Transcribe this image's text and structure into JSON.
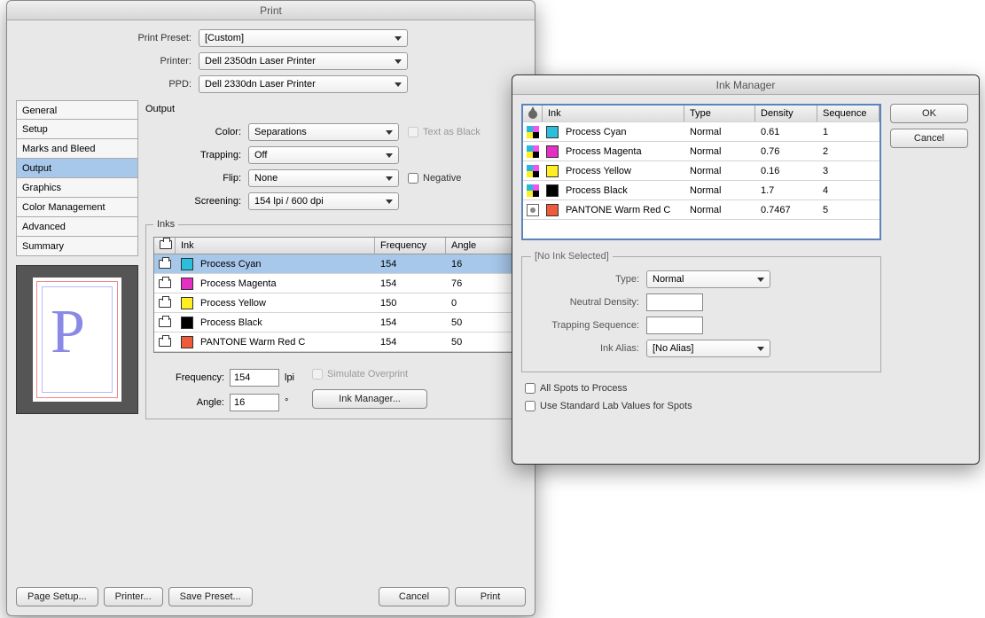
{
  "print": {
    "title": "Print",
    "preset_label": "Print Preset:",
    "preset_value": "[Custom]",
    "printer_label": "Printer:",
    "printer_value": "Dell 2350dn Laser Printer",
    "ppd_label": "PPD:",
    "ppd_value": "Dell 2330dn Laser Printer",
    "sidebar": [
      "General",
      "Setup",
      "Marks and Bleed",
      "Output",
      "Graphics",
      "Color Management",
      "Advanced",
      "Summary"
    ],
    "output_heading": "Output",
    "color_label": "Color:",
    "color_value": "Separations",
    "text_as_black": "Text as Black",
    "trapping_label": "Trapping:",
    "trapping_value": "Off",
    "flip_label": "Flip:",
    "flip_value": "None",
    "negative": "Negative",
    "screening_label": "Screening:",
    "screening_value": "154 lpi / 600 dpi",
    "inks_legend": "Inks",
    "ink_header_ink": "Ink",
    "ink_header_freq": "Frequency",
    "ink_header_angle": "Angle",
    "inks": [
      {
        "name": "Process Cyan",
        "freq": "154",
        "angle": "16",
        "color": "#2bbfdc",
        "selected": true
      },
      {
        "name": "Process Magenta",
        "freq": "154",
        "angle": "76",
        "color": "#e530c3"
      },
      {
        "name": "Process Yellow",
        "freq": "150",
        "angle": "0",
        "color": "#ffee22"
      },
      {
        "name": "Process Black",
        "freq": "154",
        "angle": "50",
        "color": "#000000"
      },
      {
        "name": "PANTONE Warm Red C",
        "freq": "154",
        "angle": "50",
        "color": "#ef5a3b"
      }
    ],
    "freq_label": "Frequency:",
    "freq_value": "154",
    "freq_unit": "lpi",
    "angle_label": "Angle:",
    "angle_value": "16",
    "angle_unit": "°",
    "simulate_overprint": "Simulate Overprint",
    "ink_manager_btn": "Ink Manager...",
    "page_setup": "Page Setup...",
    "printer_btn": "Printer...",
    "save_preset": "Save Preset...",
    "cancel": "Cancel",
    "print_btn": "Print",
    "preview_glyph": "P"
  },
  "mgr": {
    "title": "Ink Manager",
    "ok": "OK",
    "cancel": "Cancel",
    "header_ink": "Ink",
    "header_type": "Type",
    "header_density": "Density",
    "header_sequence": "Sequence",
    "rows": [
      {
        "name": "Process Cyan",
        "type": "Normal",
        "density": "0.61",
        "seq": "1",
        "color": "#2bbfdc",
        "kind": "cmyk"
      },
      {
        "name": "Process Magenta",
        "type": "Normal",
        "density": "0.76",
        "seq": "2",
        "color": "#e530c3",
        "kind": "cmyk"
      },
      {
        "name": "Process Yellow",
        "type": "Normal",
        "density": "0.16",
        "seq": "3",
        "color": "#ffee22",
        "kind": "cmyk"
      },
      {
        "name": "Process Black",
        "type": "Normal",
        "density": "1.7",
        "seq": "4",
        "color": "#000000",
        "kind": "cmyk"
      },
      {
        "name": "PANTONE Warm Red C",
        "type": "Normal",
        "density": "0.7467",
        "seq": "5",
        "color": "#ef5a3b",
        "kind": "spot"
      }
    ],
    "details_legend": "[No Ink Selected]",
    "type_label": "Type:",
    "type_value": "Normal",
    "nd_label": "Neutral Density:",
    "ts_label": "Trapping Sequence:",
    "alias_label": "Ink Alias:",
    "alias_value": "[No Alias]",
    "all_spots": "All Spots to Process",
    "lab_values": "Use Standard Lab Values for Spots"
  }
}
